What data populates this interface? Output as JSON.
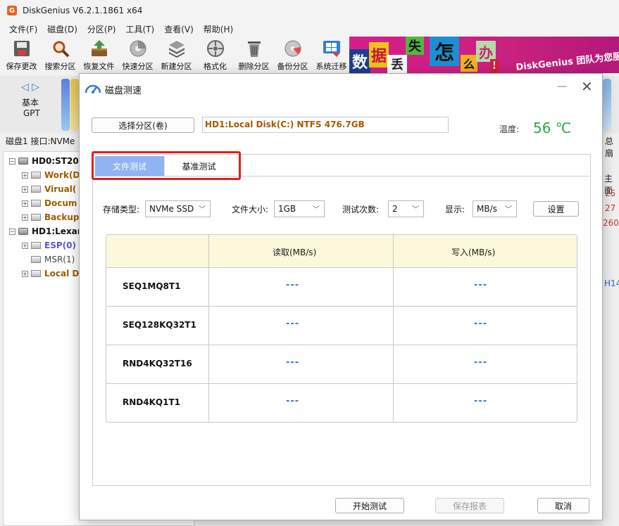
{
  "app": {
    "title": "DiskGenius V6.2.1.1861 x64",
    "logo": "G"
  },
  "menu": [
    "文件(F)",
    "磁盘(D)",
    "分区(P)",
    "工具(T)",
    "查看(V)",
    "帮助(H)"
  ],
  "toolbar": [
    {
      "label": "保存更改",
      "icon": "save-icon"
    },
    {
      "label": "搜索分区",
      "icon": "magnifier-icon"
    },
    {
      "label": "恢复文件",
      "icon": "recover-box-icon"
    },
    {
      "label": "快速分区",
      "icon": "quick-partition-icon"
    },
    {
      "label": "新建分区",
      "icon": "new-partition-icon"
    },
    {
      "label": "格式化",
      "icon": "format-icon"
    },
    {
      "label": "删除分区",
      "icon": "trash-icon"
    },
    {
      "label": "备份分区",
      "icon": "backup-disc-icon"
    },
    {
      "label": "系统迁移",
      "icon": "migrate-windows-icon"
    }
  ],
  "banner": {
    "tiles": [
      "数",
      "据",
      "丢",
      "失",
      "怎",
      "么",
      "办",
      "!"
    ],
    "text": "DiskGenius 团队为您服"
  },
  "disk_strip": {
    "basic": "基本",
    "gpt": "GPT",
    "info": "磁盘1 接口:NVMe",
    "right": "总扇"
  },
  "tree": [
    {
      "label": "HD0:ST200",
      "level": 0,
      "color": "#111111"
    },
    {
      "label": "Work(D",
      "level": 1,
      "color": "#a35a00"
    },
    {
      "label": "Virual(",
      "level": 1,
      "color": "#a35a00"
    },
    {
      "label": "Docum",
      "level": 1,
      "color": "#a35a00"
    },
    {
      "label": "Backup",
      "level": 1,
      "color": "#a35a00"
    },
    {
      "label": "HD1:Lexar",
      "level": 0,
      "color": "#111111"
    },
    {
      "label": "ESP(0)",
      "level": 1,
      "color": "#5a56d8"
    },
    {
      "label": "MSR(1)",
      "level": 1,
      "color": "#444444"
    },
    {
      "label": "Local D",
      "level": 1,
      "color": "#a35a00"
    }
  ],
  "right_partial": {
    "header": "主面",
    "v1": "25",
    "v2": "27",
    "v3": "260",
    "v4": "H14"
  },
  "dialog": {
    "title": "磁盘测速",
    "select_button": "选择分区(卷)",
    "partition": "HD1:Local Disk(C:) NTFS 476.7GB",
    "temp_label": "温度:",
    "temp_value": "56 ℃",
    "tabs": [
      "文件测试",
      "基准测试"
    ],
    "options": {
      "storage_label": "存储类型:",
      "storage_value": "NVMe SSD",
      "filesize_label": "文件大小:",
      "filesize_value": "1GB",
      "count_label": "测试次数:",
      "count_value": "2",
      "display_label": "显示:",
      "display_value": "MB/s",
      "settings_button": "设置"
    },
    "table": {
      "headers": [
        "",
        "读取(MB/s)",
        "写入(MB/s)"
      ],
      "rows": [
        {
          "name": "SEQ1MQ8T1",
          "read": "---",
          "write": "---"
        },
        {
          "name": "SEQ128KQ32T1",
          "read": "---",
          "write": "---"
        },
        {
          "name": "RND4KQ32T16",
          "read": "---",
          "write": "---"
        },
        {
          "name": "RND4KQ1T1",
          "read": "---",
          "write": "---"
        }
      ]
    },
    "buttons": {
      "start": "开始测试",
      "save_report": "保存报表",
      "cancel": "取消"
    }
  }
}
